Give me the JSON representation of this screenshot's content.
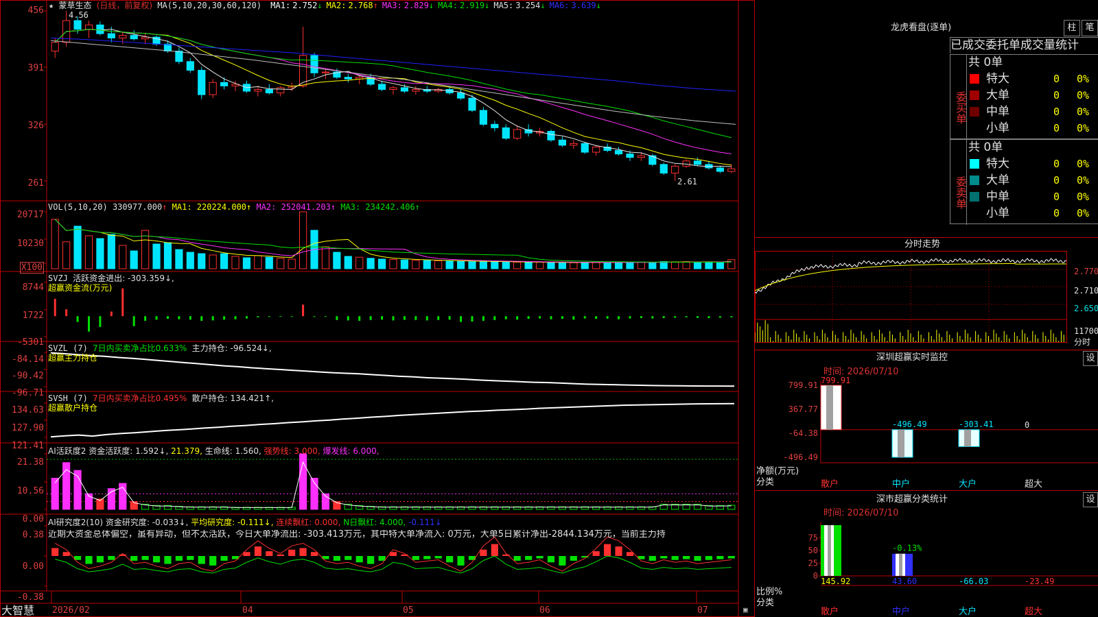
{
  "colors": {
    "up": "#ff3030",
    "down": "#00e5ff",
    "ma1": "#e8e8e8",
    "ma2": "#ffff00",
    "ma3": "#ff30ff",
    "ma4": "#00e000",
    "ma5": "#c0c0c0",
    "ma6": "#2020ff",
    "grid": "#c00000",
    "axis_text": "#e04040"
  },
  "stock": {
    "name": "蒙草生态",
    "mode": "(日线，前复权)",
    "high_mark": "4.56",
    "low_mark": "2.61"
  },
  "price_header": {
    "ma_def": "MA(5,10,20,30,60,120)",
    "items": [
      {
        "label": "MA1:",
        "value": "2.752",
        "dir": "↓",
        "color": "#ffffff"
      },
      {
        "label": "MA2:",
        "value": "2.768",
        "dir": "↑",
        "color": "#ffff00"
      },
      {
        "label": "MA3:",
        "value": "2.829",
        "dir": "↓",
        "color": "#ff30ff"
      },
      {
        "label": "MA4:",
        "value": "2.919",
        "dir": "↓",
        "color": "#00e000"
      },
      {
        "label": "MA5:",
        "value": "3.254",
        "dir": "↓",
        "color": "#e0e0e0"
      },
      {
        "label": "MA6:",
        "value": "3.639",
        "dir": "↓",
        "color": "#3030ff"
      }
    ],
    "y_ticks": [
      "456",
      "391",
      "326",
      "261"
    ]
  },
  "vol_panel": {
    "def": "VOL(5,10,20)",
    "value": "330977.000",
    "dir": "↑",
    "ma1": "MA1: 220224.000↑",
    "ma2": "MA2: 252041.203↑",
    "ma3": "MA3: 234242.406↑",
    "y_ticks": [
      "20717",
      "10230",
      "X100"
    ]
  },
  "svzj_panel": {
    "name": "SVZJ",
    "indicator": "活跃资金进出: -303.359↓,",
    "caption": "超赢资金流(万元)",
    "y_ticks": [
      "8744",
      "1722",
      "-5301"
    ]
  },
  "svzl_panel": {
    "name": "SVZL (7)",
    "ratio": "7日内买卖净占比0.633%",
    "hold": "主力持仓: -96.524↓,",
    "caption": "超赢主力持仓",
    "y_ticks": [
      "-84.14",
      "-90.42",
      "-96.71"
    ]
  },
  "svsh_panel": {
    "name": "SVSH (7)",
    "ratio": "7日内买卖净占比0.495%",
    "hold": "散户持仓: 134.421↑,",
    "caption": "超赢散户持仓",
    "y_ticks": [
      "134.63",
      "127.90",
      "121.41"
    ]
  },
  "ai_active": {
    "name": "AI活跃度2",
    "active": "资金活跃度: 1.592↓,",
    "v2": "21.379,",
    "life": "生命线: 1.560,",
    "strong": "强势线: 3.000,",
    "burst": "爆发线: 6.000,",
    "y_ticks": [
      "21.38",
      "10.56",
      "0.00"
    ]
  },
  "ai_research": {
    "name": "AI研究度2(10)",
    "research": "资金研究度: -0.033↓,",
    "avg": "平均研究度: -0.111↓,",
    "red": "连续飘红: 0.000,",
    "nred": "N日飘红: 4.000,",
    "last": "-0.111↓",
    "commentary": "近期大资金总体偏空，虽有异动，但不太活跃，今日大单净流出: -303.413万元，其中特大单净流入: 0万元，大单5日累计净出-2844.134万元，当前主力持",
    "y_ticks": [
      "0.38",
      "0.00",
      "-0.38"
    ]
  },
  "footer": {
    "brand": "大智慧",
    "dates": [
      "2026/02",
      "04",
      "05",
      "06",
      "07"
    ]
  },
  "right": {
    "title": "龙虎看盘(逐单)",
    "buttons": [
      "柱",
      "笔"
    ],
    "tabs": [
      "已成交",
      "委托单",
      "成交量统计"
    ],
    "buy": {
      "side": "委买单",
      "total": "共 0单",
      "rows": [
        {
          "label": "特大",
          "val": "0",
          "pct": "0%",
          "color": "#ff0000"
        },
        {
          "label": "大单",
          "val": "0",
          "pct": "0%",
          "color": "#a00000"
        },
        {
          "label": "中单",
          "val": "0",
          "pct": "0%",
          "color": "#700000"
        },
        {
          "label": "小单",
          "val": "0",
          "pct": "0%",
          "color": "#000000"
        }
      ]
    },
    "sell": {
      "side": "委卖单",
      "total": "共 0单",
      "rows": [
        {
          "label": "特大",
          "val": "0",
          "pct": "0%",
          "color": "#00ffff"
        },
        {
          "label": "大单",
          "val": "0",
          "pct": "0%",
          "color": "#008b8b"
        },
        {
          "label": "中单",
          "val": "0",
          "pct": "0%",
          "color": "#007070"
        },
        {
          "label": "小单",
          "val": "0",
          "pct": "0%",
          "color": "#000000"
        }
      ]
    },
    "intraday": {
      "title": "分时走势",
      "y_ticks": [
        "2.770",
        "2.710",
        "2.650"
      ],
      "vol_label": "11700",
      "vol_unit": "分时"
    },
    "monitor": {
      "title": "深圳超赢实时监控",
      "set": "设",
      "date": "时间: 2026/07/10",
      "y_ticks": [
        "799.91",
        "367.77",
        "-64.38",
        "-496.49"
      ],
      "y_label": "净额(万元)",
      "x_label": "分类",
      "categories": [
        "散户",
        "中户",
        "大户",
        "超大"
      ],
      "values": [
        799.91,
        -496.49,
        -303.41,
        0
      ],
      "value_labels": [
        "799.91",
        "-496.49",
        "-303.41",
        "0"
      ]
    },
    "classify": {
      "title": "深市超赢分类统计",
      "set": "设",
      "date": "时间: 2026/07/10",
      "y_ticks": [
        "75",
        "50",
        "25",
        "0"
      ],
      "y_label": "比例%",
      "x_label": "分类",
      "categories": [
        "散户",
        "中户",
        "大户",
        "超大"
      ],
      "values": [
        145.92,
        43.6,
        -66.03,
        -23.49
      ],
      "value_labels": [
        "145.92",
        "43.60",
        "-66.03",
        "-23.49"
      ],
      "extra": "-0.13%"
    }
  },
  "chart_data": [
    {
      "type": "candlestick",
      "title": "蒙草生态 (日线，前复权)",
      "ylim": [
        2.55,
        4.6
      ],
      "y_ticks": [
        4.56,
        3.91,
        3.26,
        2.61
      ],
      "ohlc": [
        [
          4.1,
          4.25,
          4.02,
          4.2
        ],
        [
          4.2,
          4.56,
          4.15,
          4.45
        ],
        [
          4.45,
          4.5,
          4.3,
          4.35
        ],
        [
          4.35,
          4.45,
          4.25,
          4.4
        ],
        [
          4.4,
          4.44,
          4.28,
          4.3
        ],
        [
          4.3,
          4.38,
          4.2,
          4.25
        ],
        [
          4.25,
          4.32,
          4.18,
          4.28
        ],
        [
          4.28,
          4.34,
          4.22,
          4.24
        ],
        [
          4.24,
          4.3,
          4.18,
          4.26
        ],
        [
          4.26,
          4.28,
          4.16,
          4.18
        ],
        [
          4.18,
          4.22,
          4.08,
          4.1
        ],
        [
          4.1,
          4.14,
          3.95,
          3.98
        ],
        [
          3.98,
          4.02,
          3.85,
          3.88
        ],
        [
          3.88,
          3.92,
          3.55,
          3.6
        ],
        [
          3.6,
          3.78,
          3.56,
          3.74
        ],
        [
          3.74,
          3.8,
          3.66,
          3.7
        ],
        [
          3.7,
          3.76,
          3.64,
          3.72
        ],
        [
          3.72,
          3.76,
          3.62,
          3.64
        ],
        [
          3.64,
          3.7,
          3.58,
          3.66
        ],
        [
          3.66,
          3.72,
          3.6,
          3.62
        ],
        [
          3.62,
          3.7,
          3.58,
          3.68
        ],
        [
          3.68,
          3.74,
          3.64,
          3.7
        ],
        [
          3.7,
          4.38,
          3.68,
          4.05
        ],
        [
          4.05,
          4.08,
          3.8,
          3.85
        ],
        [
          3.85,
          3.9,
          3.78,
          3.86
        ],
        [
          3.86,
          3.9,
          3.78,
          3.8
        ],
        [
          3.8,
          3.84,
          3.74,
          3.78
        ],
        [
          3.78,
          3.82,
          3.72,
          3.8
        ],
        [
          3.8,
          3.84,
          3.7,
          3.72
        ],
        [
          3.72,
          3.76,
          3.64,
          3.66
        ],
        [
          3.66,
          3.7,
          3.6,
          3.68
        ],
        [
          3.68,
          3.72,
          3.62,
          3.64
        ],
        [
          3.64,
          3.7,
          3.6,
          3.66
        ],
        [
          3.66,
          3.7,
          3.62,
          3.64
        ],
        [
          3.64,
          3.68,
          3.62,
          3.66
        ],
        [
          3.66,
          3.7,
          3.6,
          3.62
        ],
        [
          3.62,
          3.66,
          3.54,
          3.56
        ],
        [
          3.56,
          3.6,
          3.4,
          3.42
        ],
        [
          3.42,
          3.46,
          3.24,
          3.26
        ],
        [
          3.26,
          3.3,
          3.18,
          3.22
        ],
        [
          3.22,
          3.26,
          3.08,
          3.1
        ],
        [
          3.1,
          3.24,
          3.08,
          3.2
        ],
        [
          3.2,
          3.26,
          3.12,
          3.16
        ],
        [
          3.16,
          3.22,
          3.12,
          3.18
        ],
        [
          3.18,
          3.2,
          3.06,
          3.08
        ],
        [
          3.08,
          3.12,
          3.0,
          3.02
        ],
        [
          3.02,
          3.08,
          2.98,
          3.04
        ],
        [
          3.04,
          3.06,
          2.92,
          2.94
        ],
        [
          2.94,
          3.02,
          2.9,
          3.0
        ],
        [
          3.0,
          3.04,
          2.94,
          2.96
        ],
        [
          2.96,
          3.0,
          2.9,
          2.92
        ],
        [
          2.92,
          2.96,
          2.84,
          2.88
        ],
        [
          2.88,
          2.94,
          2.84,
          2.9
        ],
        [
          2.9,
          2.92,
          2.78,
          2.8
        ],
        [
          2.8,
          2.82,
          2.68,
          2.7
        ],
        [
          2.7,
          2.8,
          2.61,
          2.78
        ],
        [
          2.78,
          2.86,
          2.76,
          2.84
        ],
        [
          2.84,
          2.88,
          2.78,
          2.8
        ],
        [
          2.8,
          2.84,
          2.74,
          2.76
        ],
        [
          2.76,
          2.78,
          2.7,
          2.72
        ],
        [
          2.72,
          2.8,
          2.7,
          2.75
        ]
      ]
    },
    {
      "type": "bar",
      "title": "VOL(5,10,20)",
      "ylim": [
        0,
        20717
      ],
      "values": [
        18000,
        9800,
        15500,
        12000,
        11000,
        12500,
        8500,
        6500,
        14000,
        9000,
        9500,
        7000,
        6000,
        5500,
        5000,
        5500,
        4500,
        4000,
        4800,
        4200,
        3800,
        3500,
        20717,
        14000,
        8000,
        6000,
        4500,
        4200,
        3800,
        3500,
        3400,
        3200,
        3100,
        3000,
        2900,
        2800,
        2700,
        2600,
        2600,
        2500,
        2500,
        2400,
        2300,
        2400,
        2300,
        2200,
        2200,
        2300,
        2400,
        2200,
        2300,
        2500,
        2400,
        2300,
        2600,
        2500,
        2600,
        2400,
        2500,
        2400,
        3309
      ]
    },
    {
      "type": "bar",
      "title": "SVZJ",
      "ylim": [
        -5301,
        8744
      ],
      "values": [
        4500,
        1800,
        -1500,
        -4000,
        -2800,
        1200,
        7200,
        -2600,
        -1200,
        -900,
        -700,
        -800,
        -900,
        -1200,
        -1100,
        -900,
        -800,
        -600,
        -300,
        -200,
        -150,
        -100,
        3000,
        -200,
        -100,
        -1000,
        -1100,
        -1200,
        -1000,
        -900,
        -1100,
        -950,
        -1000,
        -1100,
        -1000,
        -900,
        -1500,
        -1400,
        -1200,
        -1000,
        -800,
        -900,
        -700,
        -600,
        -800,
        -700,
        -900,
        -600,
        -700,
        -650,
        -800,
        -600,
        -500,
        -600,
        -500,
        -400,
        -300,
        -450,
        -500,
        -400,
        -303
      ]
    },
    {
      "type": "line",
      "title": "SVZL",
      "ylim": [
        -96.71,
        -84.14
      ],
      "y_ticks": [
        -84.14,
        -90.42,
        -96.71
      ],
      "values": [
        -84.3,
        -84.6,
        -85.0,
        -85.3,
        -85.6,
        -86.0,
        -86.3,
        -86.7,
        -87.1,
        -87.5,
        -87.9,
        -88.3,
        -88.7,
        -89.1,
        -89.4,
        -89.8,
        -90.1,
        -90.4,
        -90.7,
        -91.0,
        -91.3,
        -91.6,
        -91.8,
        -92.0,
        -92.3,
        -92.6,
        -92.9,
        -93.1,
        -93.4,
        -93.6,
        -93.8,
        -94.0,
        -94.3,
        -94.5,
        -94.7,
        -94.9,
        -95.1,
        -95.2,
        -95.4,
        -95.6,
        -95.8,
        -95.9,
        -96.0,
        -96.1,
        -96.2,
        -96.3,
        -96.35,
        -96.4,
        -96.45,
        -96.5,
        -96.5,
        -96.52
      ]
    },
    {
      "type": "line",
      "title": "SVSH",
      "ylim": [
        121.41,
        134.63
      ],
      "y_ticks": [
        134.63,
        127.9,
        121.41
      ],
      "values": [
        121.6,
        122.0,
        122.3,
        121.9,
        122.5,
        122.9,
        123.2,
        123.6,
        124.0,
        124.3,
        124.6,
        125.0,
        125.3,
        125.7,
        126.0,
        126.4,
        126.7,
        127.1,
        127.4,
        127.8,
        128.1,
        128.5,
        128.8,
        129.2,
        129.5,
        129.9,
        130.2,
        130.5,
        130.8,
        131.1,
        131.4,
        131.6,
        131.9,
        132.1,
        132.3,
        132.6,
        132.8,
        133.0,
        133.2,
        133.4,
        133.6,
        133.8,
        133.9,
        134.0,
        134.1,
        134.2,
        134.3,
        134.35,
        134.4,
        134.42
      ]
    },
    {
      "type": "bar",
      "title": "AI活跃度2",
      "ylim": [
        0,
        21.38
      ],
      "y_ticks": [
        21.38,
        10.56,
        0.0
      ],
      "values": [
        12,
        18,
        15,
        6,
        4,
        8,
        10,
        3,
        2,
        1.5,
        1.5,
        1.2,
        1,
        1,
        1,
        1,
        0.8,
        0.8,
        0.8,
        0.8,
        0.8,
        0.8,
        21.38,
        12,
        6,
        3,
        2,
        1.5,
        1.2,
        1,
        1,
        1,
        1,
        1,
        1,
        1,
        1,
        1,
        1,
        1,
        1,
        1,
        1,
        1,
        1,
        1,
        1,
        1,
        1,
        1,
        1,
        1,
        1,
        1,
        2,
        2,
        2,
        2,
        1.5,
        1.5,
        1.59
      ]
    },
    {
      "type": "bar",
      "title": "AI研究度2(10)",
      "ylim": [
        -0.38,
        0.38
      ],
      "y_ticks": [
        0.38,
        0.0,
        -0.38
      ],
      "values": [
        0.1,
        0.05,
        -0.05,
        -0.1,
        -0.08,
        -0.05,
        0.02,
        -0.06,
        -0.05,
        -0.08,
        -0.1,
        -0.06,
        -0.05,
        -0.1,
        -0.12,
        -0.06,
        -0.04,
        0.05,
        0.12,
        0.06,
        0.02,
        0.08,
        0.1,
        0.05,
        -0.04,
        -0.06,
        -0.05,
        -0.08,
        -0.1,
        -0.06,
        0.05,
        0.02,
        -0.05,
        -0.04,
        -0.03,
        -0.08,
        -0.12,
        -0.05,
        0.08,
        0.15,
        0.02,
        -0.06,
        -0.05,
        -0.03,
        -0.08,
        -0.12,
        -0.06,
        -0.02,
        0.06,
        0.15,
        0.12,
        0.05,
        -0.04,
        -0.06,
        -0.03,
        -0.05,
        -0.04,
        -0.06,
        -0.05,
        -0.04,
        -0.03
      ]
    }
  ]
}
